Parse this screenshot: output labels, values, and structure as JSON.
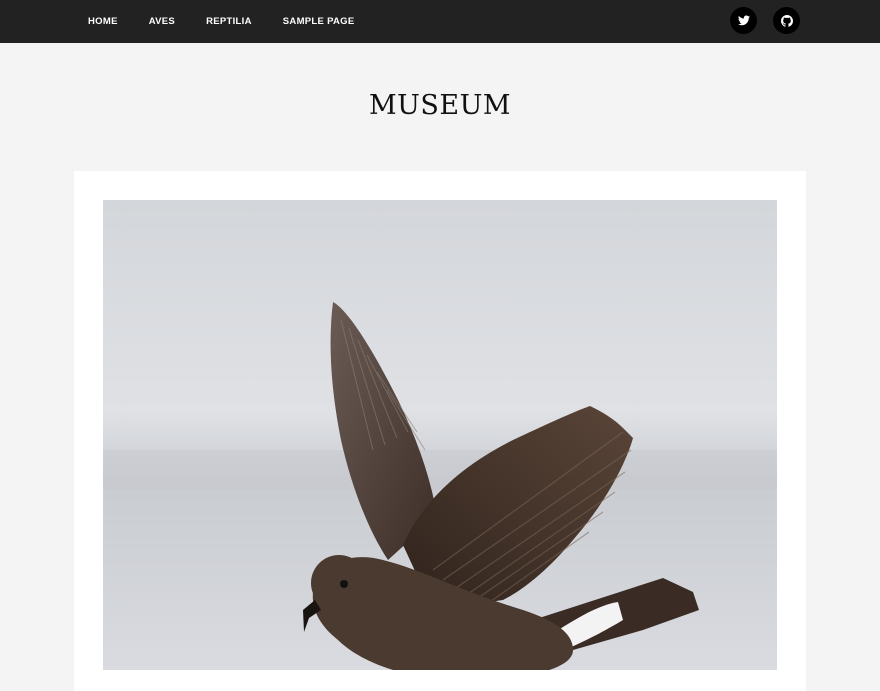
{
  "nav": {
    "items": [
      {
        "label": "HOME"
      },
      {
        "label": "AVES"
      },
      {
        "label": "REPTILIA"
      },
      {
        "label": "SAMPLE PAGE"
      }
    ]
  },
  "social": {
    "twitter_icon": "twitter-icon",
    "github_icon": "github-icon"
  },
  "site": {
    "title": "MUSEUM"
  },
  "colors": {
    "topbar": "#222222",
    "page_bg": "#f4f4f4",
    "card_bg": "#ffffff",
    "bird_brown": "#4a3a30",
    "sky": "#d6d9de"
  }
}
